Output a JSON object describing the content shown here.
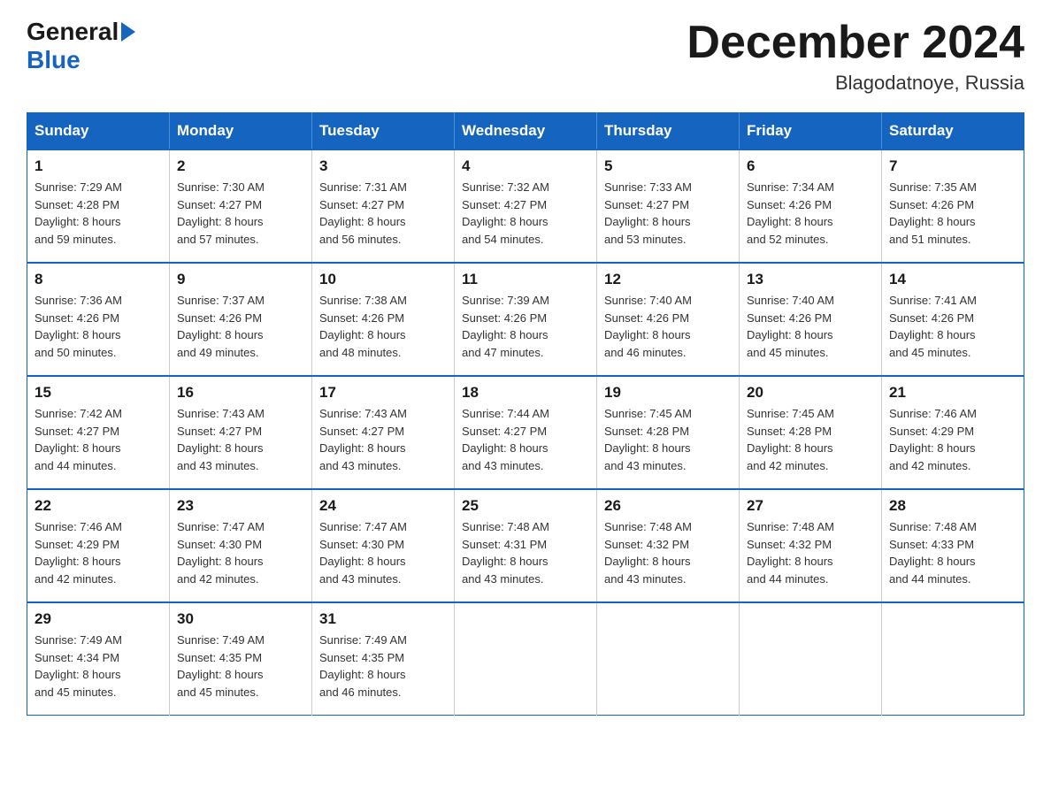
{
  "header": {
    "logo": {
      "general": "General",
      "blue": "Blue",
      "arrow": "arrow-right"
    },
    "title": "December 2024",
    "location": "Blagodatnoye, Russia"
  },
  "days_of_week": [
    "Sunday",
    "Monday",
    "Tuesday",
    "Wednesday",
    "Thursday",
    "Friday",
    "Saturday"
  ],
  "weeks": [
    [
      {
        "day": "1",
        "sunrise": "7:29 AM",
        "sunset": "4:28 PM",
        "daylight": "8 hours and 59 minutes."
      },
      {
        "day": "2",
        "sunrise": "7:30 AM",
        "sunset": "4:27 PM",
        "daylight": "8 hours and 57 minutes."
      },
      {
        "day": "3",
        "sunrise": "7:31 AM",
        "sunset": "4:27 PM",
        "daylight": "8 hours and 56 minutes."
      },
      {
        "day": "4",
        "sunrise": "7:32 AM",
        "sunset": "4:27 PM",
        "daylight": "8 hours and 54 minutes."
      },
      {
        "day": "5",
        "sunrise": "7:33 AM",
        "sunset": "4:27 PM",
        "daylight": "8 hours and 53 minutes."
      },
      {
        "day": "6",
        "sunrise": "7:34 AM",
        "sunset": "4:26 PM",
        "daylight": "8 hours and 52 minutes."
      },
      {
        "day": "7",
        "sunrise": "7:35 AM",
        "sunset": "4:26 PM",
        "daylight": "8 hours and 51 minutes."
      }
    ],
    [
      {
        "day": "8",
        "sunrise": "7:36 AM",
        "sunset": "4:26 PM",
        "daylight": "8 hours and 50 minutes."
      },
      {
        "day": "9",
        "sunrise": "7:37 AM",
        "sunset": "4:26 PM",
        "daylight": "8 hours and 49 minutes."
      },
      {
        "day": "10",
        "sunrise": "7:38 AM",
        "sunset": "4:26 PM",
        "daylight": "8 hours and 48 minutes."
      },
      {
        "day": "11",
        "sunrise": "7:39 AM",
        "sunset": "4:26 PM",
        "daylight": "8 hours and 47 minutes."
      },
      {
        "day": "12",
        "sunrise": "7:40 AM",
        "sunset": "4:26 PM",
        "daylight": "8 hours and 46 minutes."
      },
      {
        "day": "13",
        "sunrise": "7:40 AM",
        "sunset": "4:26 PM",
        "daylight": "8 hours and 45 minutes."
      },
      {
        "day": "14",
        "sunrise": "7:41 AM",
        "sunset": "4:26 PM",
        "daylight": "8 hours and 45 minutes."
      }
    ],
    [
      {
        "day": "15",
        "sunrise": "7:42 AM",
        "sunset": "4:27 PM",
        "daylight": "8 hours and 44 minutes."
      },
      {
        "day": "16",
        "sunrise": "7:43 AM",
        "sunset": "4:27 PM",
        "daylight": "8 hours and 43 minutes."
      },
      {
        "day": "17",
        "sunrise": "7:43 AM",
        "sunset": "4:27 PM",
        "daylight": "8 hours and 43 minutes."
      },
      {
        "day": "18",
        "sunrise": "7:44 AM",
        "sunset": "4:27 PM",
        "daylight": "8 hours and 43 minutes."
      },
      {
        "day": "19",
        "sunrise": "7:45 AM",
        "sunset": "4:28 PM",
        "daylight": "8 hours and 43 minutes."
      },
      {
        "day": "20",
        "sunrise": "7:45 AM",
        "sunset": "4:28 PM",
        "daylight": "8 hours and 42 minutes."
      },
      {
        "day": "21",
        "sunrise": "7:46 AM",
        "sunset": "4:29 PM",
        "daylight": "8 hours and 42 minutes."
      }
    ],
    [
      {
        "day": "22",
        "sunrise": "7:46 AM",
        "sunset": "4:29 PM",
        "daylight": "8 hours and 42 minutes."
      },
      {
        "day": "23",
        "sunrise": "7:47 AM",
        "sunset": "4:30 PM",
        "daylight": "8 hours and 42 minutes."
      },
      {
        "day": "24",
        "sunrise": "7:47 AM",
        "sunset": "4:30 PM",
        "daylight": "8 hours and 43 minutes."
      },
      {
        "day": "25",
        "sunrise": "7:48 AM",
        "sunset": "4:31 PM",
        "daylight": "8 hours and 43 minutes."
      },
      {
        "day": "26",
        "sunrise": "7:48 AM",
        "sunset": "4:32 PM",
        "daylight": "8 hours and 43 minutes."
      },
      {
        "day": "27",
        "sunrise": "7:48 AM",
        "sunset": "4:32 PM",
        "daylight": "8 hours and 44 minutes."
      },
      {
        "day": "28",
        "sunrise": "7:48 AM",
        "sunset": "4:33 PM",
        "daylight": "8 hours and 44 minutes."
      }
    ],
    [
      {
        "day": "29",
        "sunrise": "7:49 AM",
        "sunset": "4:34 PM",
        "daylight": "8 hours and 45 minutes."
      },
      {
        "day": "30",
        "sunrise": "7:49 AM",
        "sunset": "4:35 PM",
        "daylight": "8 hours and 45 minutes."
      },
      {
        "day": "31",
        "sunrise": "7:49 AM",
        "sunset": "4:35 PM",
        "daylight": "8 hours and 46 minutes."
      },
      null,
      null,
      null,
      null
    ]
  ],
  "labels": {
    "sunrise": "Sunrise:",
    "sunset": "Sunset:",
    "daylight": "Daylight:"
  }
}
